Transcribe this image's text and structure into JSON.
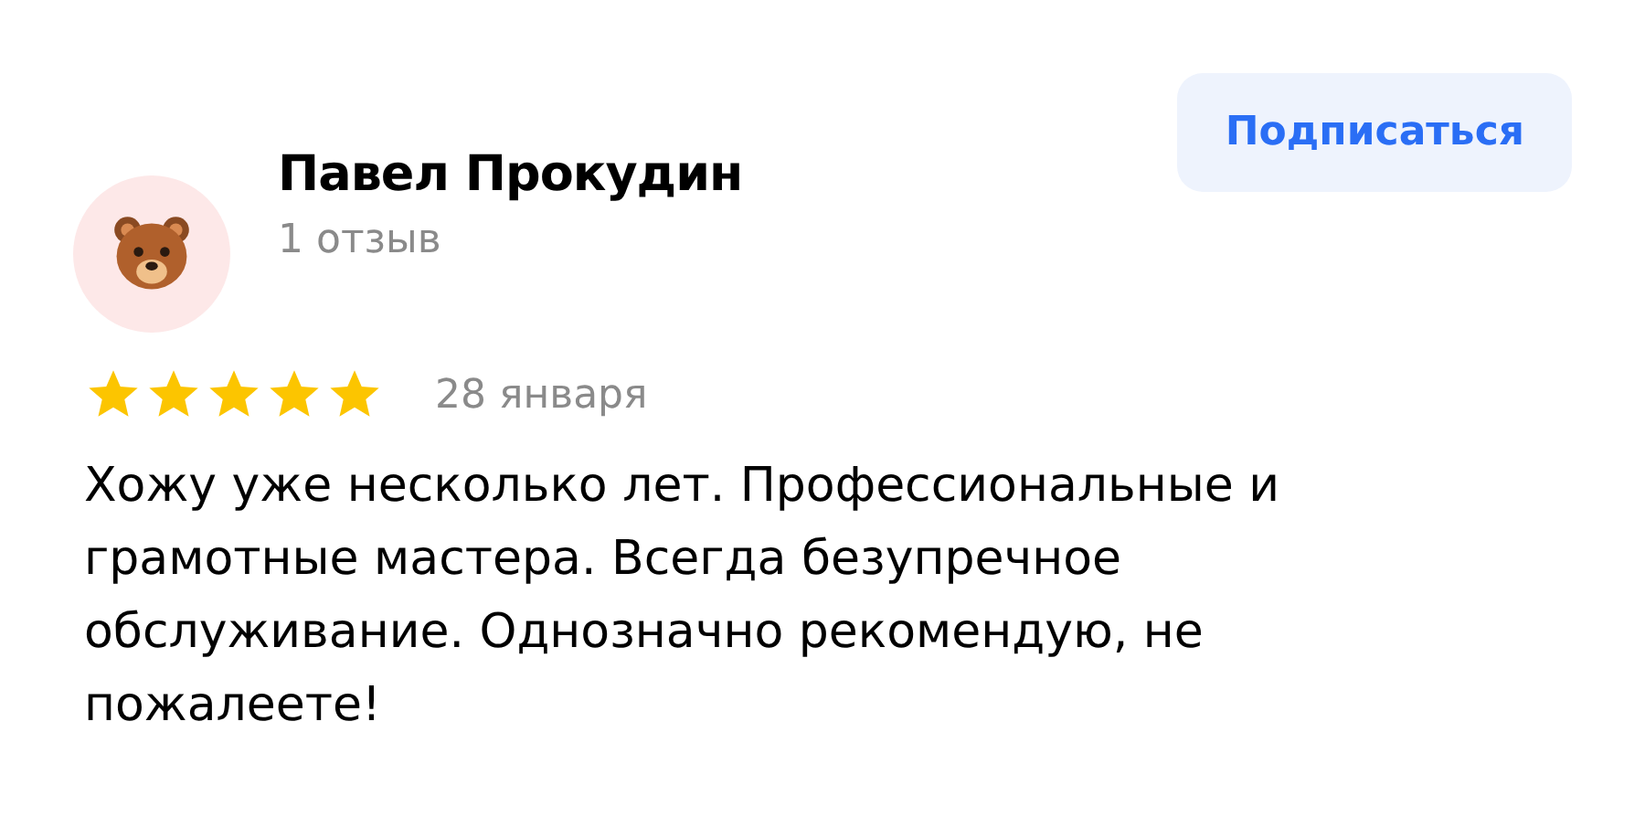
{
  "author": {
    "name": "Павел Прокудин",
    "reviews": "1 отзыв"
  },
  "subscribe_button": "Подписаться",
  "rating": {
    "stars": 5
  },
  "date": "28 января",
  "review_text": "Хожу уже несколько лет. Профессиональные и грамотные мастера. Всегда безупречное обслуживание. Однозначно рекомендую, не пожалеете!"
}
